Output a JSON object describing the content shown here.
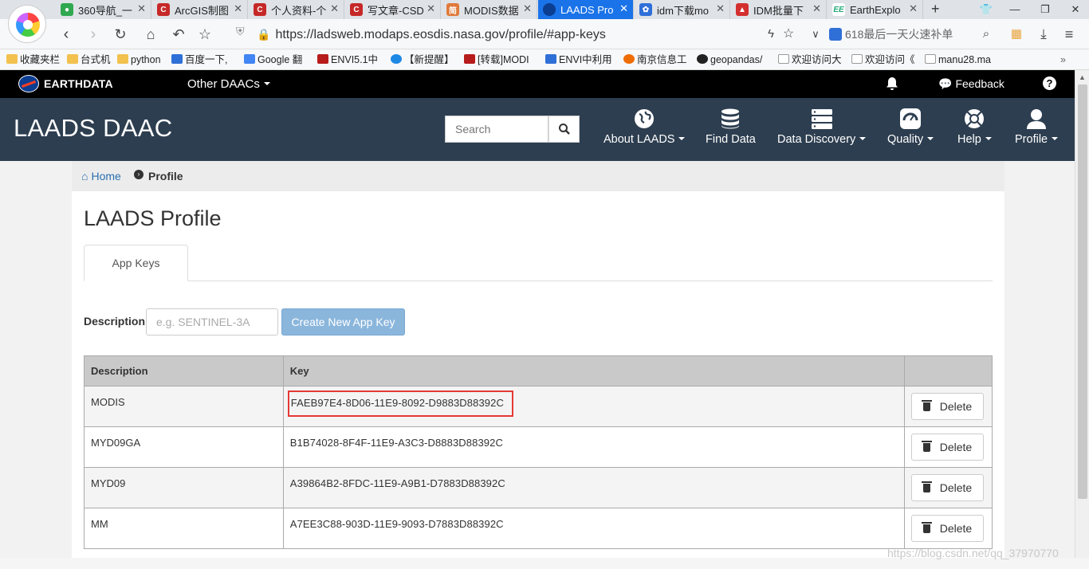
{
  "browser": {
    "tabs": [
      {
        "title": "360导航_一",
        "color": "#2fa84f",
        "icon": "360-icon"
      },
      {
        "title": "ArcGIS制图",
        "color": "#c62828",
        "icon": "csdn-icon"
      },
      {
        "title": "个人资料-个",
        "color": "#c62828",
        "icon": "csdn-icon"
      },
      {
        "title": "写文章-CSD",
        "color": "#c62828",
        "icon": "csdn-icon"
      },
      {
        "title": "MODIS数据",
        "color": "#e07a3a",
        "icon": "jianshu-icon"
      },
      {
        "title": "LAADS Pro",
        "color": "#0b3d91",
        "icon": "nasa-icon",
        "active": true
      },
      {
        "title": "idm下载mo",
        "color": "#2f6fd8",
        "icon": "baidu-icon"
      },
      {
        "title": "IDM批量下",
        "color": "#d32f2f",
        "icon": "idm-icon"
      },
      {
        "title": "EarthExplo",
        "color": "#ffffff",
        "icon": "ee-icon"
      }
    ],
    "url": "https://ladsweb.modaps.eosdis.nasa.gov/profile/#app-keys",
    "search_text": "618最后一天火速补单",
    "bookmarks": [
      {
        "label": "收藏夹栏",
        "icon": "folder-icon"
      },
      {
        "label": "台式机",
        "icon": "folder-icon"
      },
      {
        "label": "python",
        "icon": "folder-icon"
      },
      {
        "label": "百度一下,",
        "icon": "baidu-icon"
      },
      {
        "label": "Google 翻",
        "icon": "google-translate-icon"
      },
      {
        "label": "ENVI5.1中",
        "icon": "envi-icon"
      },
      {
        "label": "【新提醒】",
        "icon": "edge-icon"
      },
      {
        "label": "[转载]MODI",
        "icon": "envi-icon"
      },
      {
        "label": "ENVI中利用",
        "icon": "baidu-icon"
      },
      {
        "label": "南京信息工",
        "icon": "nuist-icon"
      },
      {
        "label": "geopandas/",
        "icon": "github-icon"
      },
      {
        "label": "欢迎访问大",
        "icon": "page-icon"
      },
      {
        "label": "欢迎访问《",
        "icon": "page-icon"
      },
      {
        "label": "manu28.ma",
        "icon": "page-icon"
      }
    ]
  },
  "earthdata": {
    "brand": "EARTHDATA",
    "other_daacs": "Other DAACs",
    "feedback": "Feedback",
    "help": "?"
  },
  "header": {
    "title": "LAADS DAAC",
    "search_placeholder": "Search",
    "menu": [
      {
        "label": "About LAADS",
        "icon": "globe-icon",
        "caret": true
      },
      {
        "label": "Find Data",
        "icon": "database-icon",
        "caret": false
      },
      {
        "label": "Data Discovery",
        "icon": "server-icon",
        "caret": true
      },
      {
        "label": "Quality",
        "icon": "gauge-icon",
        "caret": true
      },
      {
        "label": "Help",
        "icon": "lifebuoy-icon",
        "caret": true
      },
      {
        "label": "Profile",
        "icon": "user-icon",
        "caret": true
      }
    ]
  },
  "breadcrumb": {
    "home": "Home",
    "current": "Profile"
  },
  "page": {
    "title": "LAADS Profile",
    "tab": "App Keys",
    "description_label": "Description",
    "description_placeholder": "e.g. SENTINEL-3A",
    "create_button": "Create New App Key",
    "table": {
      "headers": [
        "Description",
        "Key",
        ""
      ],
      "rows": [
        {
          "description": "MODIS",
          "key": "FAEB97E4-8D06-11E9-8092-D9883D88392C",
          "action": "Delete",
          "highlighted": true
        },
        {
          "description": "MYD09GA",
          "key": "B1B74028-8F4F-11E9-A3C3-D8883D88392C",
          "action": "Delete"
        },
        {
          "description": "MYD09",
          "key": "A39864B2-8FDC-11E9-A9B1-D7883D88392C",
          "action": "Delete"
        },
        {
          "description": "MM",
          "key": "A7EE3C88-903D-11E9-9093-D7883D88392C",
          "action": "Delete"
        }
      ]
    }
  },
  "watermark": "https://blog.csdn.net/qq_37970770",
  "colors": {
    "accent": "#1a73e8",
    "header_bg": "#2d3e50",
    "highlight": "#e53935",
    "create_button": "#8bb6dc"
  }
}
